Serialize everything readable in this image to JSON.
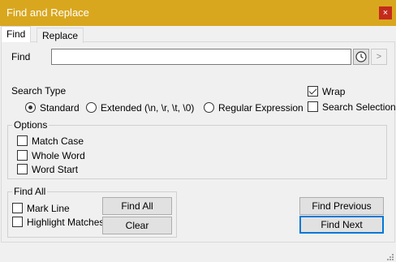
{
  "window": {
    "title": "Find and Replace",
    "close_glyph": "×"
  },
  "tabs": [
    {
      "label": "Find",
      "active": true
    },
    {
      "label": "Replace",
      "active": false
    }
  ],
  "find": {
    "label": "Find",
    "value": "",
    "history_icon": "clock-icon",
    "go_glyph": ">"
  },
  "search_type": {
    "label": "Search Type",
    "options": [
      {
        "label": "Standard",
        "checked": true
      },
      {
        "label": "Extended (\\n, \\r, \\t, \\0)",
        "checked": false
      },
      {
        "label": "Regular Expression",
        "checked": false
      }
    ]
  },
  "toggles": {
    "wrap": {
      "label": "Wrap",
      "checked": true
    },
    "search_selection": {
      "label": "Search Selection",
      "checked": false
    }
  },
  "options_group": {
    "label": "Options",
    "items": [
      {
        "label": "Match Case",
        "checked": false
      },
      {
        "label": "Whole Word",
        "checked": false
      },
      {
        "label": "Word Start",
        "checked": false
      }
    ]
  },
  "find_all_group": {
    "label": "Find All",
    "mark_line": {
      "label": "Mark Line",
      "checked": false
    },
    "highlight_matches": {
      "label": "Highlight Matches",
      "checked": false
    },
    "find_all_button": "Find All",
    "clear_button": "Clear"
  },
  "nav_buttons": {
    "find_previous": "Find Previous",
    "find_next": "Find Next"
  },
  "colors": {
    "titlebar": "#d9a71e",
    "close": "#c42b1c",
    "focus": "#0078d7"
  }
}
